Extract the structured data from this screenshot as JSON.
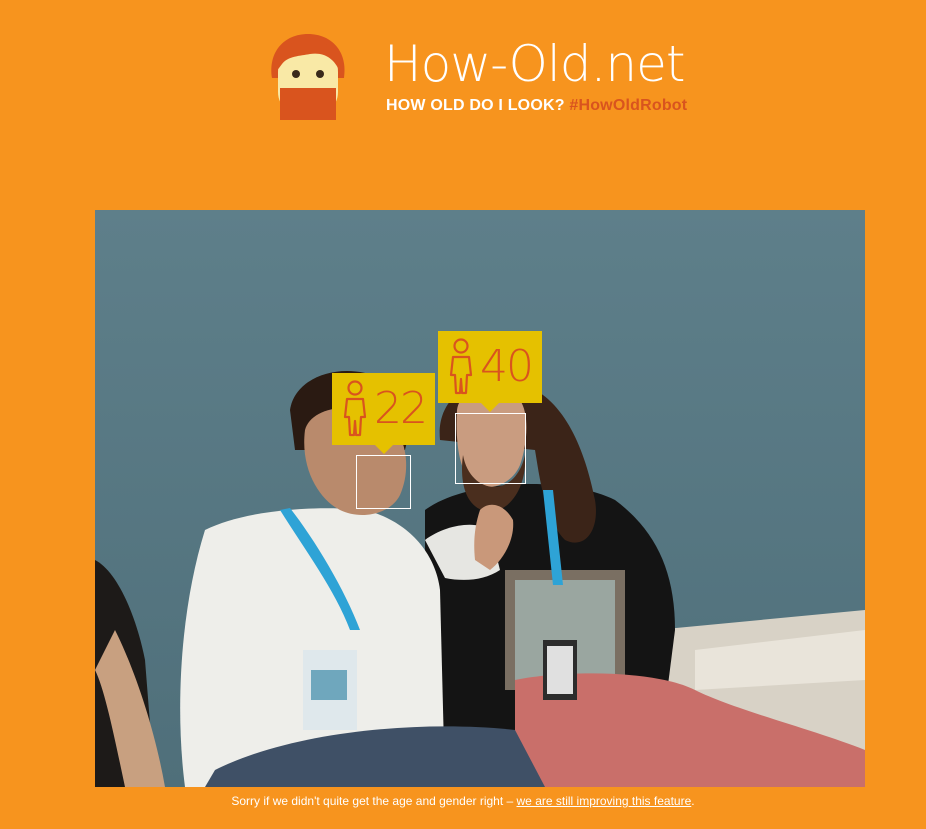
{
  "header": {
    "title": "How-Old.net",
    "tagline": "HOW OLD DO I LOOK?",
    "hashtag": "#HowOldRobot"
  },
  "photo": {
    "faces": [
      {
        "gender": "male",
        "age": "22"
      },
      {
        "gender": "male",
        "age": "40"
      }
    ]
  },
  "footer": {
    "disclaimer_text": "Sorry if we didn't quite get the age and gender right – ",
    "disclaimer_link": "we are still improving this feature",
    "disclaimer_end": "."
  },
  "colors": {
    "background": "#f7941e",
    "badge": "#e5c100",
    "accent": "#d9541e",
    "text": "#ffffff"
  }
}
